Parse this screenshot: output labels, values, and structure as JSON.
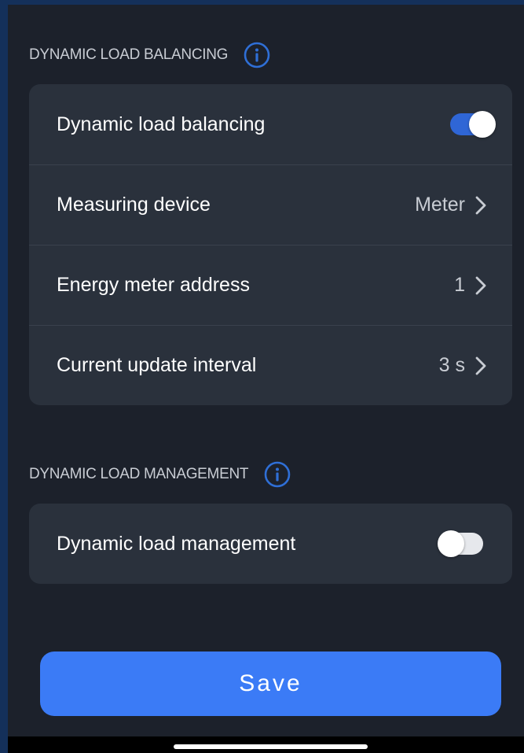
{
  "colors": {
    "background": "#1c212b",
    "card": "#2a313c",
    "accent": "#3b7bf6",
    "toggle_on": "#2f66d6",
    "info_icon": "#2f6fd6"
  },
  "balancing_section": {
    "title": "DYNAMIC LOAD BALANCING",
    "info_icon": "info-icon",
    "rows": [
      {
        "label": "Dynamic load balancing",
        "toggle": true
      },
      {
        "label": "Measuring device",
        "value": "Meter",
        "icon": "chevron-right-icon"
      },
      {
        "label": "Energy meter address",
        "value": "1",
        "icon": "chevron-right-icon"
      },
      {
        "label": "Current update interval",
        "value": "3 s",
        "icon": "chevron-right-icon"
      }
    ]
  },
  "management_section": {
    "title": "DYNAMIC LOAD MANAGEMENT",
    "info_icon": "info-icon",
    "rows": [
      {
        "label": "Dynamic load management",
        "toggle": false
      }
    ]
  },
  "save_button": {
    "label": "Save"
  }
}
